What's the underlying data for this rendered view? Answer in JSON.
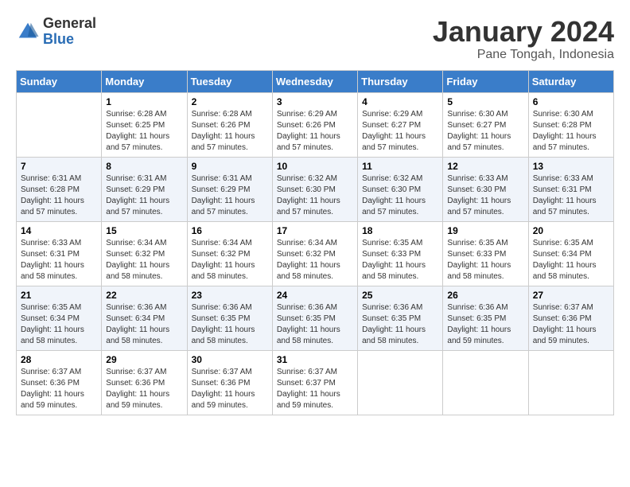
{
  "logo": {
    "text_general": "General",
    "text_blue": "Blue"
  },
  "title": "January 2024",
  "subtitle": "Pane Tongah, Indonesia",
  "days_of_week": [
    "Sunday",
    "Monday",
    "Tuesday",
    "Wednesday",
    "Thursday",
    "Friday",
    "Saturday"
  ],
  "weeks": [
    [
      {
        "day": "",
        "sunrise": "",
        "sunset": "",
        "daylight": ""
      },
      {
        "day": "1",
        "sunrise": "6:28 AM",
        "sunset": "6:25 PM",
        "daylight": "11 hours and 57 minutes."
      },
      {
        "day": "2",
        "sunrise": "6:28 AM",
        "sunset": "6:26 PM",
        "daylight": "11 hours and 57 minutes."
      },
      {
        "day": "3",
        "sunrise": "6:29 AM",
        "sunset": "6:26 PM",
        "daylight": "11 hours and 57 minutes."
      },
      {
        "day": "4",
        "sunrise": "6:29 AM",
        "sunset": "6:27 PM",
        "daylight": "11 hours and 57 minutes."
      },
      {
        "day": "5",
        "sunrise": "6:30 AM",
        "sunset": "6:27 PM",
        "daylight": "11 hours and 57 minutes."
      },
      {
        "day": "6",
        "sunrise": "6:30 AM",
        "sunset": "6:28 PM",
        "daylight": "11 hours and 57 minutes."
      }
    ],
    [
      {
        "day": "7",
        "sunrise": "6:31 AM",
        "sunset": "6:28 PM",
        "daylight": "11 hours and 57 minutes."
      },
      {
        "day": "8",
        "sunrise": "6:31 AM",
        "sunset": "6:29 PM",
        "daylight": "11 hours and 57 minutes."
      },
      {
        "day": "9",
        "sunrise": "6:31 AM",
        "sunset": "6:29 PM",
        "daylight": "11 hours and 57 minutes."
      },
      {
        "day": "10",
        "sunrise": "6:32 AM",
        "sunset": "6:30 PM",
        "daylight": "11 hours and 57 minutes."
      },
      {
        "day": "11",
        "sunrise": "6:32 AM",
        "sunset": "6:30 PM",
        "daylight": "11 hours and 57 minutes."
      },
      {
        "day": "12",
        "sunrise": "6:33 AM",
        "sunset": "6:30 PM",
        "daylight": "11 hours and 57 minutes."
      },
      {
        "day": "13",
        "sunrise": "6:33 AM",
        "sunset": "6:31 PM",
        "daylight": "11 hours and 57 minutes."
      }
    ],
    [
      {
        "day": "14",
        "sunrise": "6:33 AM",
        "sunset": "6:31 PM",
        "daylight": "11 hours and 58 minutes."
      },
      {
        "day": "15",
        "sunrise": "6:34 AM",
        "sunset": "6:32 PM",
        "daylight": "11 hours and 58 minutes."
      },
      {
        "day": "16",
        "sunrise": "6:34 AM",
        "sunset": "6:32 PM",
        "daylight": "11 hours and 58 minutes."
      },
      {
        "day": "17",
        "sunrise": "6:34 AM",
        "sunset": "6:32 PM",
        "daylight": "11 hours and 58 minutes."
      },
      {
        "day": "18",
        "sunrise": "6:35 AM",
        "sunset": "6:33 PM",
        "daylight": "11 hours and 58 minutes."
      },
      {
        "day": "19",
        "sunrise": "6:35 AM",
        "sunset": "6:33 PM",
        "daylight": "11 hours and 58 minutes."
      },
      {
        "day": "20",
        "sunrise": "6:35 AM",
        "sunset": "6:34 PM",
        "daylight": "11 hours and 58 minutes."
      }
    ],
    [
      {
        "day": "21",
        "sunrise": "6:35 AM",
        "sunset": "6:34 PM",
        "daylight": "11 hours and 58 minutes."
      },
      {
        "day": "22",
        "sunrise": "6:36 AM",
        "sunset": "6:34 PM",
        "daylight": "11 hours and 58 minutes."
      },
      {
        "day": "23",
        "sunrise": "6:36 AM",
        "sunset": "6:35 PM",
        "daylight": "11 hours and 58 minutes."
      },
      {
        "day": "24",
        "sunrise": "6:36 AM",
        "sunset": "6:35 PM",
        "daylight": "11 hours and 58 minutes."
      },
      {
        "day": "25",
        "sunrise": "6:36 AM",
        "sunset": "6:35 PM",
        "daylight": "11 hours and 58 minutes."
      },
      {
        "day": "26",
        "sunrise": "6:36 AM",
        "sunset": "6:35 PM",
        "daylight": "11 hours and 59 minutes."
      },
      {
        "day": "27",
        "sunrise": "6:37 AM",
        "sunset": "6:36 PM",
        "daylight": "11 hours and 59 minutes."
      }
    ],
    [
      {
        "day": "28",
        "sunrise": "6:37 AM",
        "sunset": "6:36 PM",
        "daylight": "11 hours and 59 minutes."
      },
      {
        "day": "29",
        "sunrise": "6:37 AM",
        "sunset": "6:36 PM",
        "daylight": "11 hours and 59 minutes."
      },
      {
        "day": "30",
        "sunrise": "6:37 AM",
        "sunset": "6:36 PM",
        "daylight": "11 hours and 59 minutes."
      },
      {
        "day": "31",
        "sunrise": "6:37 AM",
        "sunset": "6:37 PM",
        "daylight": "11 hours and 59 minutes."
      },
      {
        "day": "",
        "sunrise": "",
        "sunset": "",
        "daylight": ""
      },
      {
        "day": "",
        "sunrise": "",
        "sunset": "",
        "daylight": ""
      },
      {
        "day": "",
        "sunrise": "",
        "sunset": "",
        "daylight": ""
      }
    ]
  ],
  "labels": {
    "sunrise_prefix": "Sunrise: ",
    "sunset_prefix": "Sunset: ",
    "daylight_prefix": "Daylight: "
  }
}
